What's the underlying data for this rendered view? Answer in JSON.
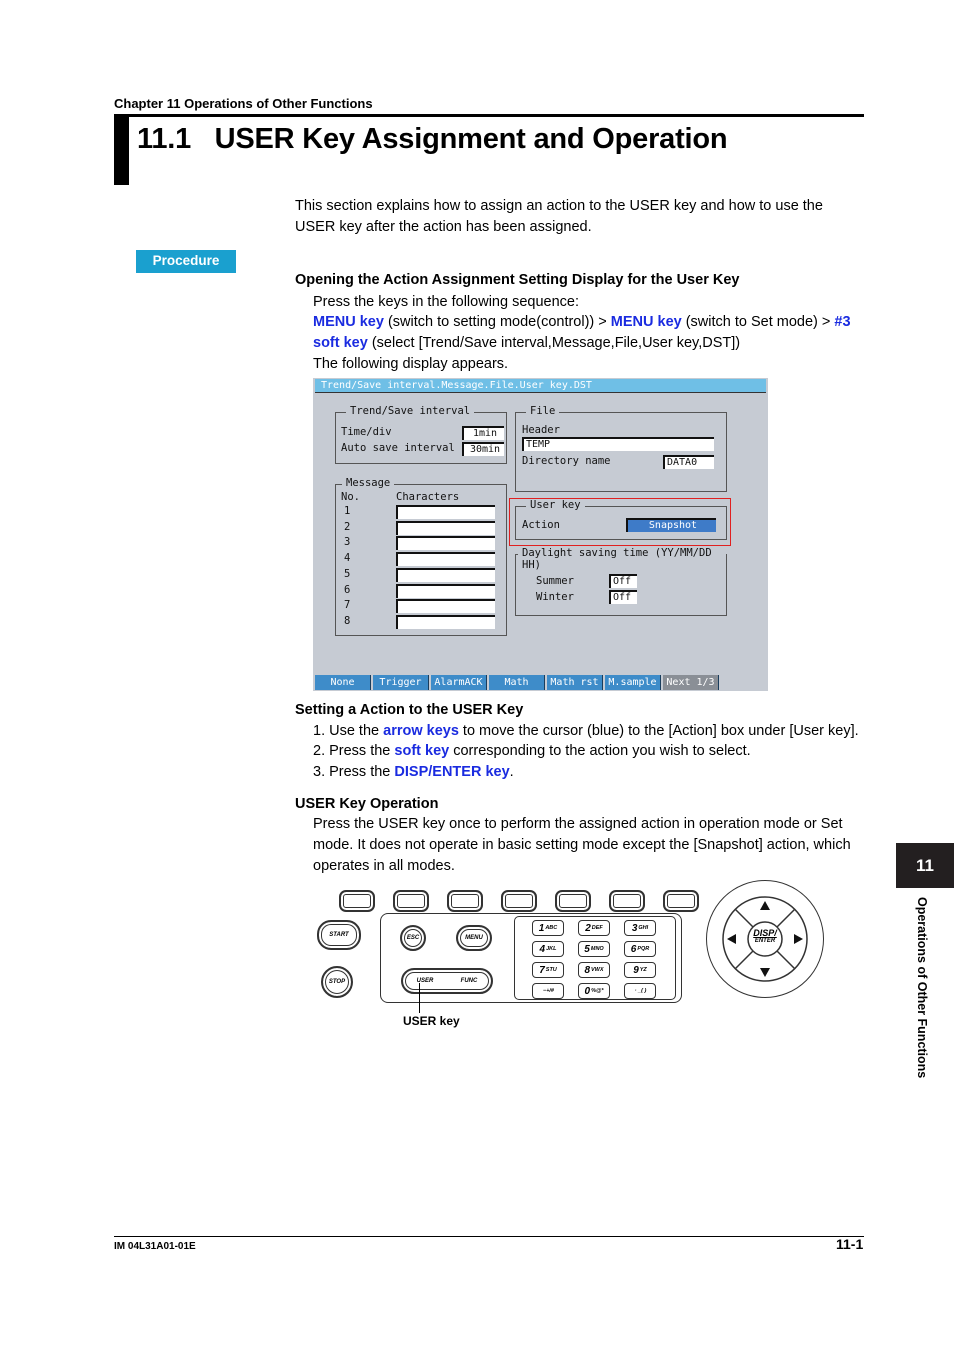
{
  "header": {
    "chapter": "Chapter 11 Operations of Other Functions",
    "title": "11.1   USER Key Assignment and Operation"
  },
  "intro": "This section explains how to assign an action to the USER key and how to use the USER key after the action has been assigned.",
  "procedure_badge": "Procedure",
  "section1": {
    "heading": "Opening the Action Assignment Setting Display for the User Key",
    "line1": "Press the keys in the following sequence:",
    "seq": {
      "k1": "MENU key",
      "t1": " (switch to setting mode(control)) > ",
      "k2": "MENU key",
      "t2": " (switch to Set mode) > ",
      "k3": "#3 soft key",
      "t3": " (select [Trend/Save interval,Message,File,User key,DST])"
    },
    "line3": "The following display appears."
  },
  "screen": {
    "title": "Trend/Save interval.Message.File.User key.DST",
    "trend": {
      "label": "Trend/Save interval",
      "time_div_label": "Time/div",
      "time_div_value": "1min",
      "auto_save_label": "Auto save interval",
      "auto_save_value": "30min"
    },
    "file": {
      "label": "File",
      "header_label": "Header",
      "header_value": "TEMP",
      "dir_label": "Directory name",
      "dir_value": "DATA0"
    },
    "message": {
      "label": "Message",
      "no_label": "No.",
      "chars_label": "Characters",
      "rows": [
        "1",
        "2",
        "3",
        "4",
        "5",
        "6",
        "7",
        "8"
      ]
    },
    "userkey": {
      "label": "User key",
      "action_label": "Action",
      "action_value": "Snapshot"
    },
    "dst": {
      "label": "Daylight saving time (YY/MM/DD HH)",
      "summer_label": "Summer",
      "summer_value": "Off",
      "winter_label": "Winter",
      "winter_value": "Off"
    },
    "softkeys": [
      "None",
      "Trigger",
      "AlarmACK",
      "Math",
      "Math rst",
      "M.sample",
      "Next 1/3"
    ]
  },
  "section2": {
    "heading": "Setting a Action to the USER Key",
    "s1a": "1.  Use the ",
    "s1k": "arrow keys",
    "s1b": " to move the cursor (blue) to the [Action] box under [User key].",
    "s2a": "2.  Press the ",
    "s2k": "soft key",
    "s2b": " corresponding to the action you wish to select.",
    "s3a": "3.  Press the ",
    "s3k": "DISP/ENTER key",
    "s3b": "."
  },
  "section3": {
    "heading": "USER Key Operation",
    "body": "Press the USER key once to perform the assigned action in operation mode or Set mode.  It does not operate in basic setting mode except the [Snapshot] action, which operates in all modes."
  },
  "keypad": {
    "start": "START",
    "stop": "STOP",
    "esc": "ESC",
    "menu": "MENU",
    "user": "USER",
    "func": "FUNC",
    "numkeys": [
      {
        "n": "1",
        "s": "ABC"
      },
      {
        "n": "2",
        "s": "DEF"
      },
      {
        "n": "3",
        "s": "GHI"
      },
      {
        "n": "4",
        "s": "JKL"
      },
      {
        "n": "5",
        "s": "MNO"
      },
      {
        "n": "6",
        "s": "PQR"
      },
      {
        "n": "7",
        "s": "STU"
      },
      {
        "n": "8",
        "s": "VWX"
      },
      {
        "n": "9",
        "s": "YZ"
      },
      {
        "n": "",
        "s": "−+/#"
      },
      {
        "n": "0",
        "s": "%@*"
      },
      {
        "n": "",
        "s": "· _( )"
      }
    ],
    "disp": "DISP/",
    "enter": "ENTER",
    "callout": "USER key"
  },
  "side_tab": {
    "number": "11",
    "text": "Operations of Other Functions"
  },
  "footer": {
    "doc_id": "IM 04L31A01-01E",
    "page": "11-1"
  }
}
